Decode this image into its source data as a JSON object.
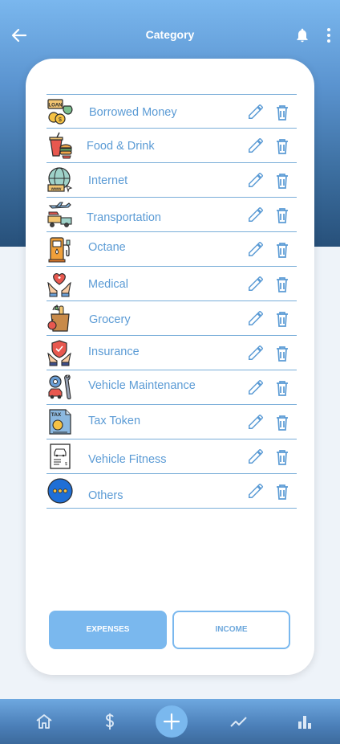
{
  "header": {
    "title": "Category",
    "back_icon": "arrow-left-icon",
    "notification_icon": "bell-icon",
    "menu_icon": "more-vertical-icon"
  },
  "categories": [
    {
      "label": "Borrowed Money",
      "icon": "loan-icon"
    },
    {
      "label": "Food & Drink",
      "icon": "food-drink-icon"
    },
    {
      "label": "Internet",
      "icon": "globe-www-icon"
    },
    {
      "label": "Transportation",
      "icon": "transportation-icon"
    },
    {
      "label": "Octane",
      "icon": "fuel-pump-icon"
    },
    {
      "label": "Medical",
      "icon": "medical-heart-icon"
    },
    {
      "label": "Grocery",
      "icon": "grocery-bag-icon"
    },
    {
      "label": "Insurance",
      "icon": "shield-hands-icon"
    },
    {
      "label": "Vehicle Maintenance",
      "icon": "vehicle-maintenance-icon"
    },
    {
      "label": "Tax Token",
      "icon": "tax-document-icon"
    },
    {
      "label": "Vehicle Fitness",
      "icon": "vehicle-certificate-icon"
    },
    {
      "label": "Others",
      "icon": "more-dots-icon"
    }
  ],
  "row_actions": {
    "edit_icon": "pencil-icon",
    "delete_icon": "trash-icon"
  },
  "tabs": {
    "expenses": "EXPENSES",
    "income": "INCOME",
    "active": "expenses"
  },
  "bottom_nav": [
    "home-icon",
    "dollar-icon",
    "plus-icon",
    "trend-icon",
    "bar-chart-icon"
  ],
  "colors": {
    "accent": "#7ab8ee",
    "label": "#5b9bd5",
    "header_top": "#7ab7ee",
    "header_bottom": "#27507a"
  }
}
